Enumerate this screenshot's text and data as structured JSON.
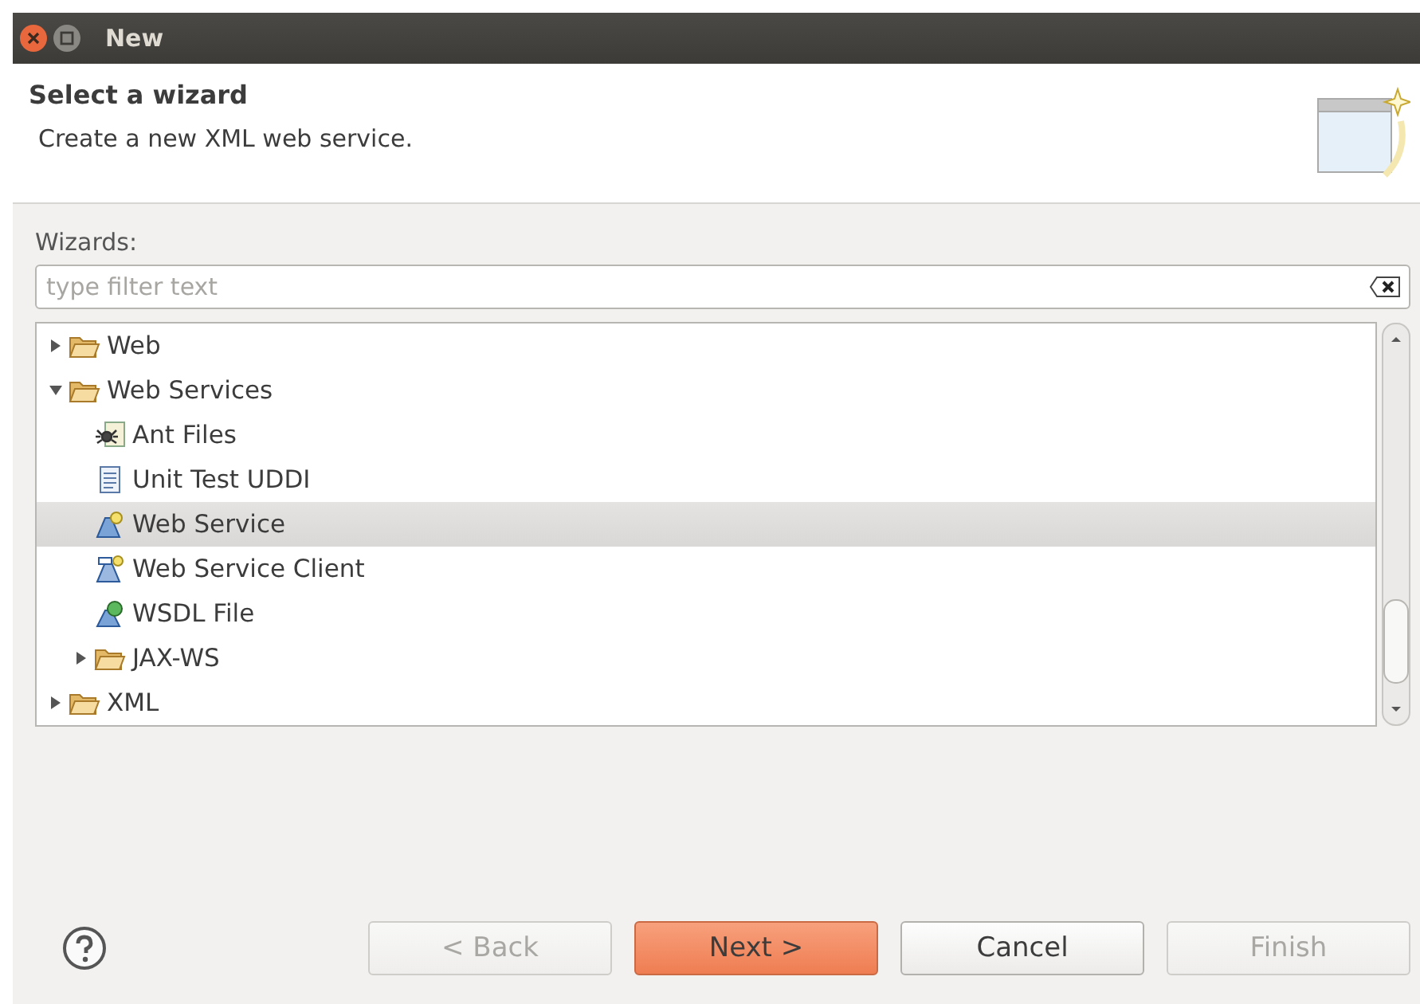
{
  "window": {
    "title": "New"
  },
  "header": {
    "title": "Select a wizard",
    "description": "Create a new XML web service."
  },
  "wizards_label": "Wizards:",
  "filter": {
    "placeholder": "type filter text"
  },
  "tree": [
    {
      "label": "Web",
      "kind": "folder",
      "expanded": false,
      "selected": false
    },
    {
      "label": "Web Services",
      "kind": "folder",
      "expanded": true,
      "selected": false,
      "children": [
        {
          "label": "Ant Files",
          "kind": "ant",
          "selected": false
        },
        {
          "label": "Unit Test UDDI",
          "kind": "list",
          "selected": false
        },
        {
          "label": "Web Service",
          "kind": "service",
          "selected": true
        },
        {
          "label": "Web Service Client",
          "kind": "client",
          "selected": false
        },
        {
          "label": "WSDL File",
          "kind": "wsdl",
          "selected": false
        },
        {
          "label": "JAX-WS",
          "kind": "folder",
          "expanded": false,
          "selected": false
        }
      ]
    },
    {
      "label": "XML",
      "kind": "folder",
      "expanded": false,
      "selected": false
    }
  ],
  "buttons": [
    {
      "label": "< Back",
      "disabled": true,
      "default": false
    },
    {
      "label": "Next >",
      "disabled": false,
      "default": true
    },
    {
      "label": "Cancel",
      "disabled": false,
      "default": false
    },
    {
      "label": "Finish",
      "disabled": true,
      "default": false
    }
  ]
}
